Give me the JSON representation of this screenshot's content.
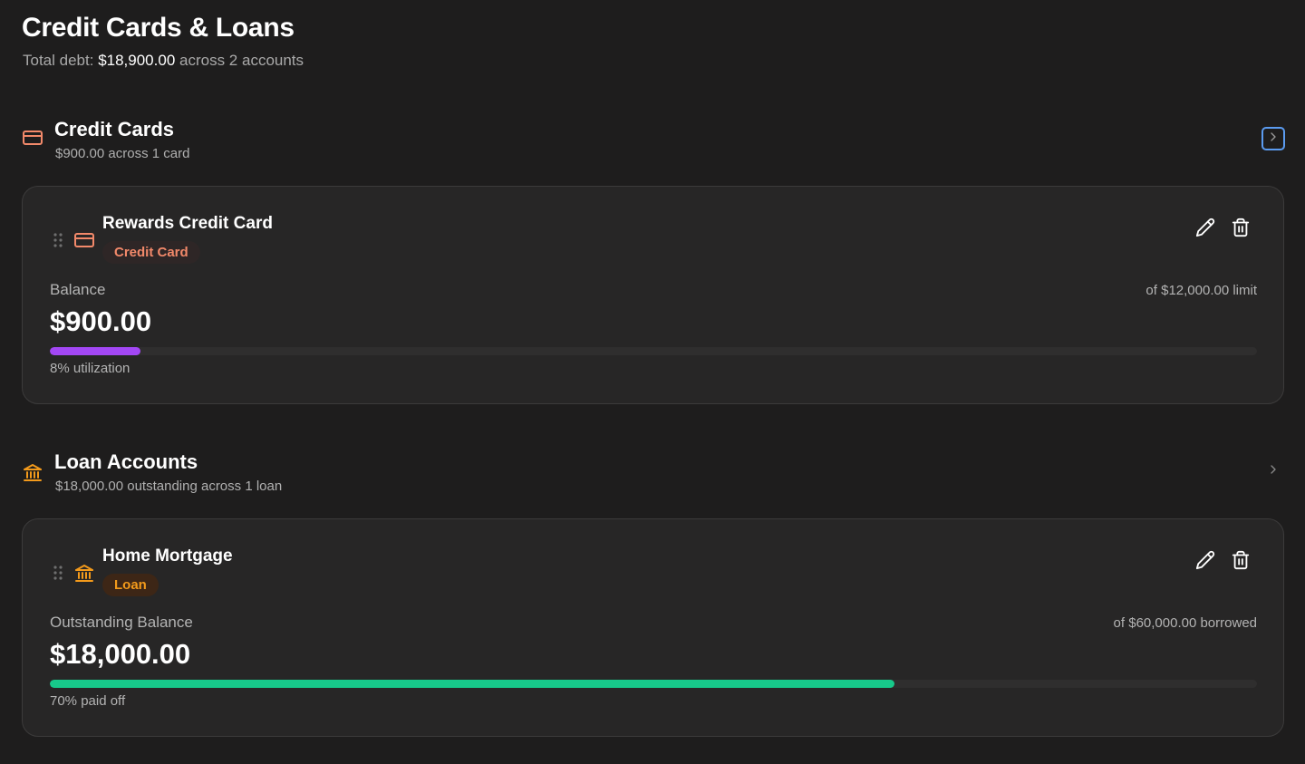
{
  "page": {
    "title": "Credit Cards & Loans",
    "subtitle_prefix": "Total debt:",
    "total_debt": "$18,900.00",
    "subtitle_suffix": "across 2 accounts"
  },
  "sections": [
    {
      "title": "Credit Cards",
      "subtitle": "$900.00 across 1 card",
      "icon": "credit-card-icon",
      "accent": "#f2896a",
      "accounts": [
        {
          "name": "Rewards Credit Card",
          "badge": "Credit Card",
          "icon": "credit-card-icon",
          "balance_label": "Balance",
          "balance": "$900.00",
          "limit_text": "of $12,000.00 limit",
          "progress_percent": 7.5,
          "progress_color": "#a347f5",
          "caption": "8% utilization"
        }
      ]
    },
    {
      "title": "Loan Accounts",
      "subtitle": "$18,000.00 outstanding across 1 loan",
      "icon": "bank-icon",
      "accent": "#f39a1b",
      "accounts": [
        {
          "name": "Home Mortgage",
          "badge": "Loan",
          "icon": "bank-icon",
          "balance_label": "Outstanding Balance",
          "balance": "$18,000.00",
          "limit_text": "of $60,000.00 borrowed",
          "progress_percent": 70,
          "progress_color": "#17c98a",
          "caption": "70% paid off"
        }
      ]
    }
  ]
}
